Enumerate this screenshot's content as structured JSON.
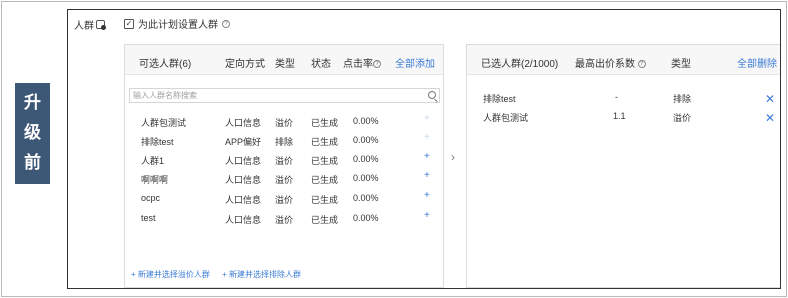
{
  "banner": {
    "chars": [
      "升",
      "级",
      "前"
    ]
  },
  "field": {
    "label": "人群"
  },
  "checkbox": {
    "label": "为此计划设置人群",
    "checked": true
  },
  "left_panel": {
    "title": "可选人群(6)",
    "columns": {
      "method": "定向方式",
      "type": "类型",
      "status": "状态",
      "ctr": "点击率"
    },
    "add_all": "全部添加",
    "search_placeholder": "输入人群名称搜索",
    "rows": [
      {
        "name": "人群包测试",
        "method": "人口信息",
        "type": "溢价",
        "status": "已生成",
        "ctr": "0.00%",
        "added": true
      },
      {
        "name": "排除test",
        "method": "APP偏好",
        "type": "排除",
        "status": "已生成",
        "ctr": "0.00%",
        "added": true
      },
      {
        "name": "人群1",
        "method": "人口信息",
        "type": "溢价",
        "status": "已生成",
        "ctr": "0.00%",
        "added": false
      },
      {
        "name": "啊啊啊",
        "method": "人口信息",
        "type": "溢价",
        "status": "已生成",
        "ctr": "0.00%",
        "added": false
      },
      {
        "name": "ocpc",
        "method": "人口信息",
        "type": "溢价",
        "status": "已生成",
        "ctr": "0.00%",
        "added": false
      },
      {
        "name": "test",
        "method": "人口信息",
        "type": "溢价",
        "status": "已生成",
        "ctr": "0.00%",
        "added": false
      }
    ],
    "new_premium": "+ 新建并选择溢价人群",
    "new_exclude": "+ 新建并选择排除人群"
  },
  "right_panel": {
    "title": "已选人群(2/1000)",
    "columns": {
      "max_bid": "最高出价系数",
      "type": "类型"
    },
    "remove_all": "全部删除",
    "rows": [
      {
        "name": "排除test",
        "max_bid": "-",
        "type": "排除"
      },
      {
        "name": "人群包测试",
        "max_bid": "1.1",
        "type": "溢价"
      }
    ]
  },
  "colors": {
    "banner_bg": "#3d5777",
    "link": "#3a7bd5"
  }
}
